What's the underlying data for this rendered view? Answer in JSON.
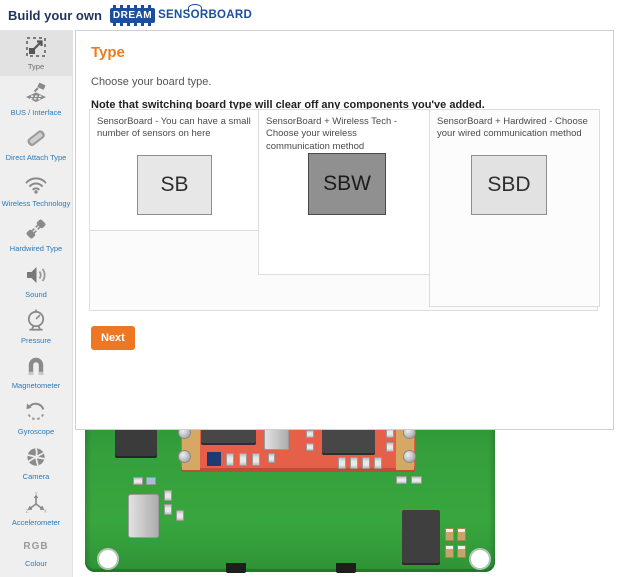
{
  "header": {
    "title": "Build your own",
    "logo": {
      "chip": "DREAM",
      "sens": "SENS",
      "o": "O",
      "rest": "RBOARD"
    }
  },
  "colors": {
    "accent_orange": "#ee7723",
    "logo_blue": "#1a4f9e",
    "sidebar_link_blue": "#2a7ab9",
    "selected_box_gray": "#909090",
    "pcb_green": "#35a03c",
    "pcb_module_red": "#e55f49"
  },
  "sidebar": {
    "items": [
      {
        "label": "Type",
        "selected": true
      },
      {
        "label": "BUS / Interface",
        "selected": false
      },
      {
        "label": "Direct Attach Type",
        "selected": false
      },
      {
        "label": "Wireless Technology",
        "selected": false
      },
      {
        "label": "Hardwired Type",
        "selected": false
      },
      {
        "label": "Sound",
        "selected": false
      },
      {
        "label": "Pressure",
        "selected": false
      },
      {
        "label": "Magnetometer",
        "selected": false
      },
      {
        "label": "Gyroscope",
        "selected": false
      },
      {
        "label": "Camera",
        "selected": false
      },
      {
        "label": "Accelerometer",
        "selected": false
      },
      {
        "label": "Colour",
        "selected": false,
        "icon_text": "RGB"
      }
    ]
  },
  "panel": {
    "title": "Type",
    "subtitle": "Choose your board type.",
    "note": "Note that switching board type will clear off any components you've added.",
    "cards": [
      {
        "description": "SensorBoard - You can have a small number of sensors on here",
        "code": "SB",
        "selected": false
      },
      {
        "description": "SensorBoard + Wireless Tech - Choose your wireless communication method",
        "code": "SBW",
        "selected": true
      },
      {
        "description": "SensorBoard + Hardwired - Choose your wired communication method",
        "code": "SBD",
        "selected": false
      }
    ],
    "next_label": "Next"
  }
}
